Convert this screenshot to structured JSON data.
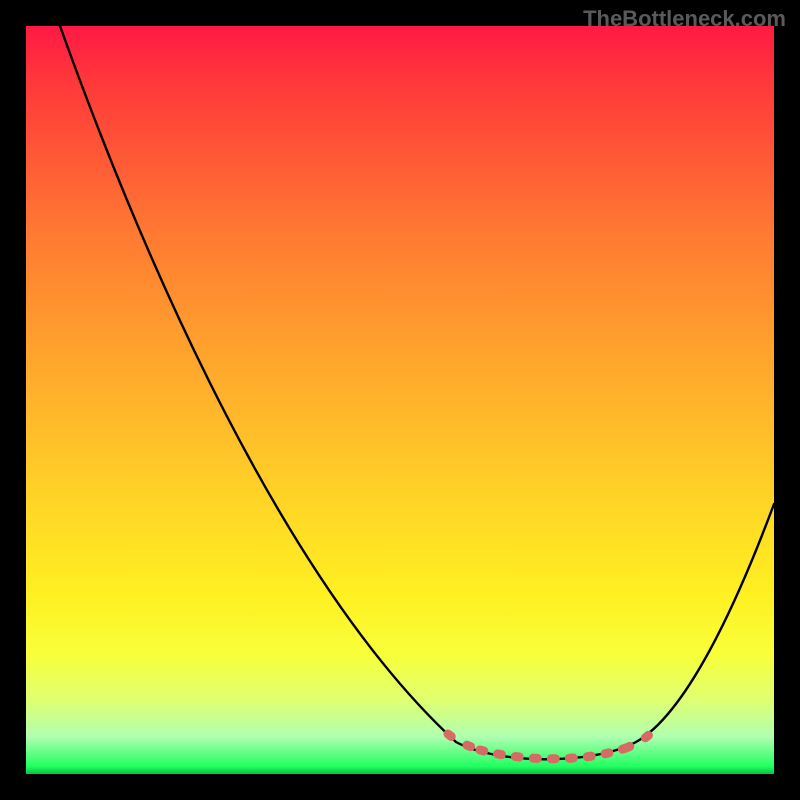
{
  "watermark": "TheBottleneck.com",
  "chart_data": {
    "type": "line",
    "title": "",
    "xlabel": "",
    "ylabel": "",
    "xlim": [
      0,
      100
    ],
    "ylim": [
      0,
      100
    ],
    "grid": false,
    "legend": false,
    "background_gradient": {
      "direction": "vertical",
      "stops": [
        {
          "pos": 0.0,
          "color": "#ff1a44"
        },
        {
          "pos": 0.4,
          "color": "#ff9a2e"
        },
        {
          "pos": 0.76,
          "color": "#fff022"
        },
        {
          "pos": 0.95,
          "color": "#b0ffb0"
        },
        {
          "pos": 1.0,
          "color": "#08c040"
        }
      ]
    },
    "series": [
      {
        "name": "bottleneck-curve",
        "color": "#000000",
        "x": [
          4,
          10,
          20,
          30,
          40,
          50,
          57,
          63,
          70,
          76,
          80,
          85,
          90,
          95,
          100
        ],
        "y": [
          100,
          86,
          66,
          46,
          28,
          14,
          6,
          2,
          0.5,
          0.5,
          2,
          6,
          14,
          26,
          36
        ]
      }
    ],
    "annotations": [
      {
        "name": "optimal-range-highlight",
        "type": "dashed-segment",
        "color": "#d66b63",
        "x_range": [
          56,
          84
        ],
        "note": "valley / optimal-balance region emphasized with salmon dashed stroke"
      }
    ]
  }
}
